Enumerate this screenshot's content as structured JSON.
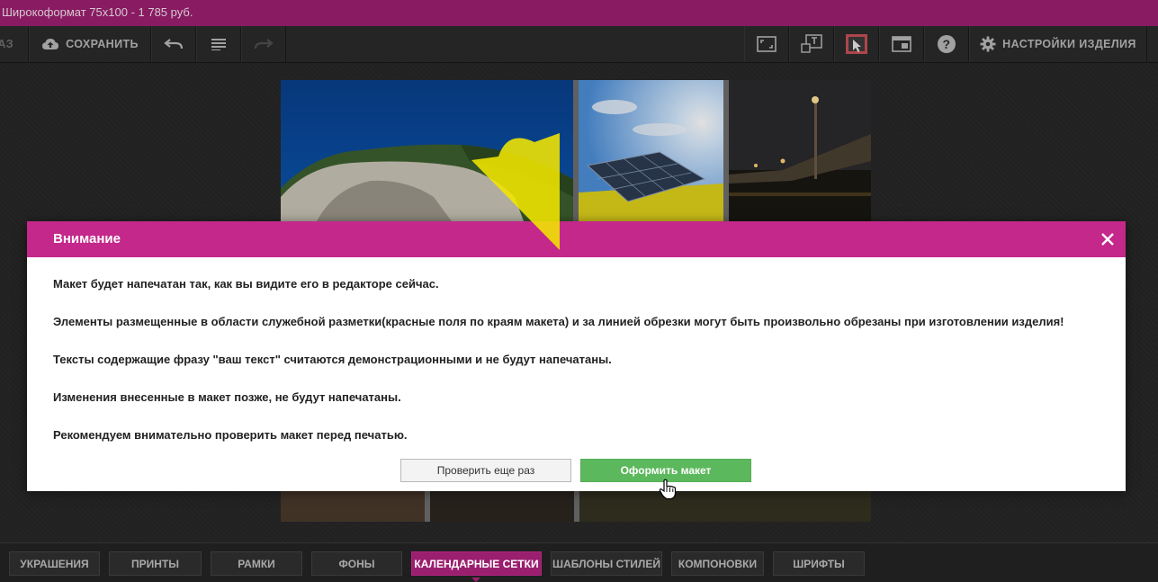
{
  "window": {
    "title": "Широкоформат 75x100 - 1 785 руб."
  },
  "toolbar": {
    "left_cut_label": "АЗ",
    "save_label": "СОХРАНИТЬ",
    "settings_label": "НАСТРОЙКИ ИЗДЕЛИЯ",
    "icons": [
      "cloud-upload-icon",
      "undo-icon",
      "list-icon",
      "redo-icon",
      "fullscreen-icon",
      "text-frame-icon",
      "preview-icon",
      "layout-icon",
      "help-icon",
      "gear-icon"
    ]
  },
  "modal": {
    "title": "Внимание",
    "lines": [
      "Макет будет напечатан так, как вы видите его в редакторе сейчас.",
      "Элементы размещенные в области служебной разметки(красные поля по краям макета) и за линией обрезки могут быть произвольно обрезаны при изготовлении изделия!",
      "Тексты содержащие фразу \"ваш текст\" считаются демонстрационными и не будут напечатаны.",
      "Изменения внесенные в макет позже, не будут напечатаны.",
      "Рекомендуем внимательно проверить макет перед печатью."
    ],
    "secondary_button": "Проверить еще раз",
    "primary_button": "Оформить макет"
  },
  "tabs": [
    {
      "label": "УКРАШЕНИЯ",
      "active": false
    },
    {
      "label": "ПРИНТЫ",
      "active": false
    },
    {
      "label": "РАМКИ",
      "active": false
    },
    {
      "label": "ФОНЫ",
      "active": false
    },
    {
      "label": "КАЛЕНДАРНЫЕ СЕТКИ",
      "active": true
    },
    {
      "label": "ШАБЛОНЫ СТИЛЕЙ",
      "active": false
    },
    {
      "label": "КОМПОНОВКИ",
      "active": false
    },
    {
      "label": "ШРИФТЫ",
      "active": false
    }
  ],
  "colors": {
    "brand": "#9b1f6f",
    "modal_header": "#c4288b",
    "primary_button": "#5cb85c",
    "arrow": "#f2e600"
  }
}
